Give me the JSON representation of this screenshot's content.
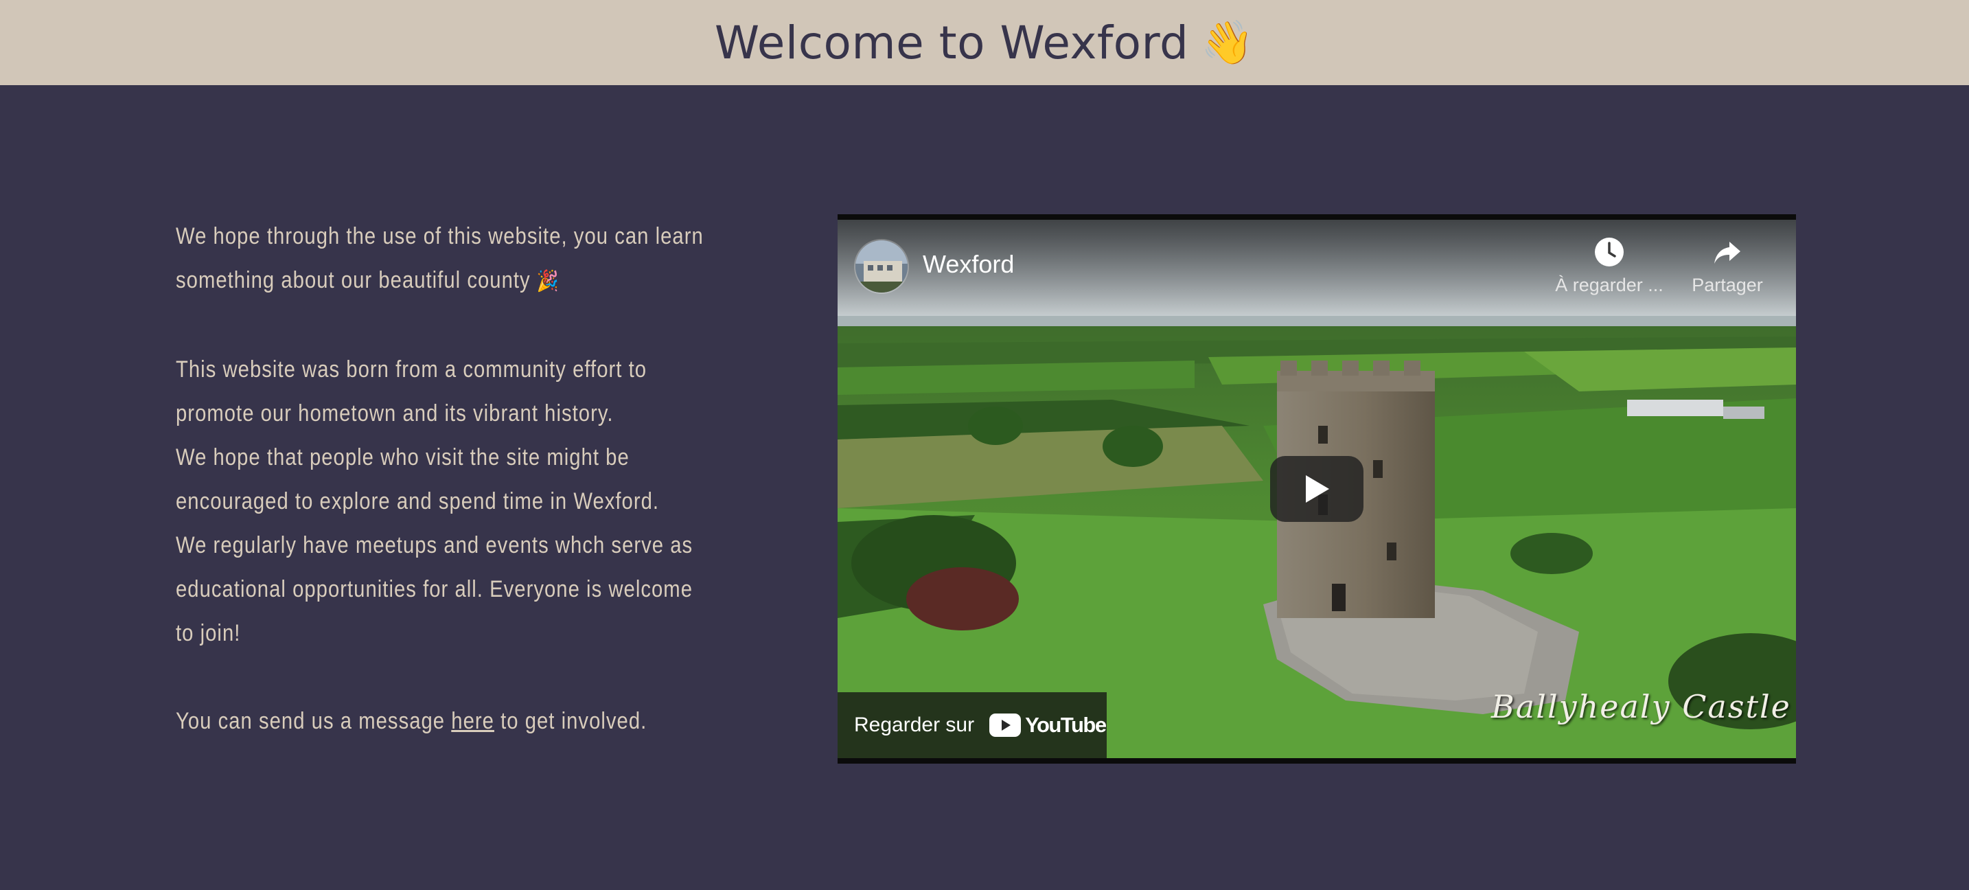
{
  "header": {
    "title": "Welcome to Wexford",
    "emoji": "👋"
  },
  "intro": {
    "p1": "We hope through the use of this website, you can learn something about our beautiful county",
    "p1_emoji": "🎉",
    "p2a": "This website was born from a community effort to promote our hometown and its vibrant history.",
    "p2b": "We hope that people who visit the site might be encouraged to explore and spend time in Wexford.",
    "p2c": "We regularly have meetups and events whch serve as educational opportunities for all. Everyone is welcome to join!",
    "p3_before": "You can send us a message",
    "p3_link": "here",
    "p3_after": "to get involved."
  },
  "video": {
    "channel_title": "Wexford",
    "watch_later_label": "À regarder ...",
    "share_label": "Partager",
    "watch_on_label": "Regarder sur",
    "youtube_label": "YouTube",
    "overlay_caption": "Ballyhealy Castle"
  },
  "colors": {
    "page_background": "#37344b",
    "header_background": "#d1c6b8",
    "text_light": "#d9cdbc",
    "heading_text": "#37344b"
  },
  "icons": {
    "watch_later": "clock-icon",
    "share": "share-arrow-icon",
    "play": "play-icon",
    "youtube": "youtube-logo-icon"
  }
}
